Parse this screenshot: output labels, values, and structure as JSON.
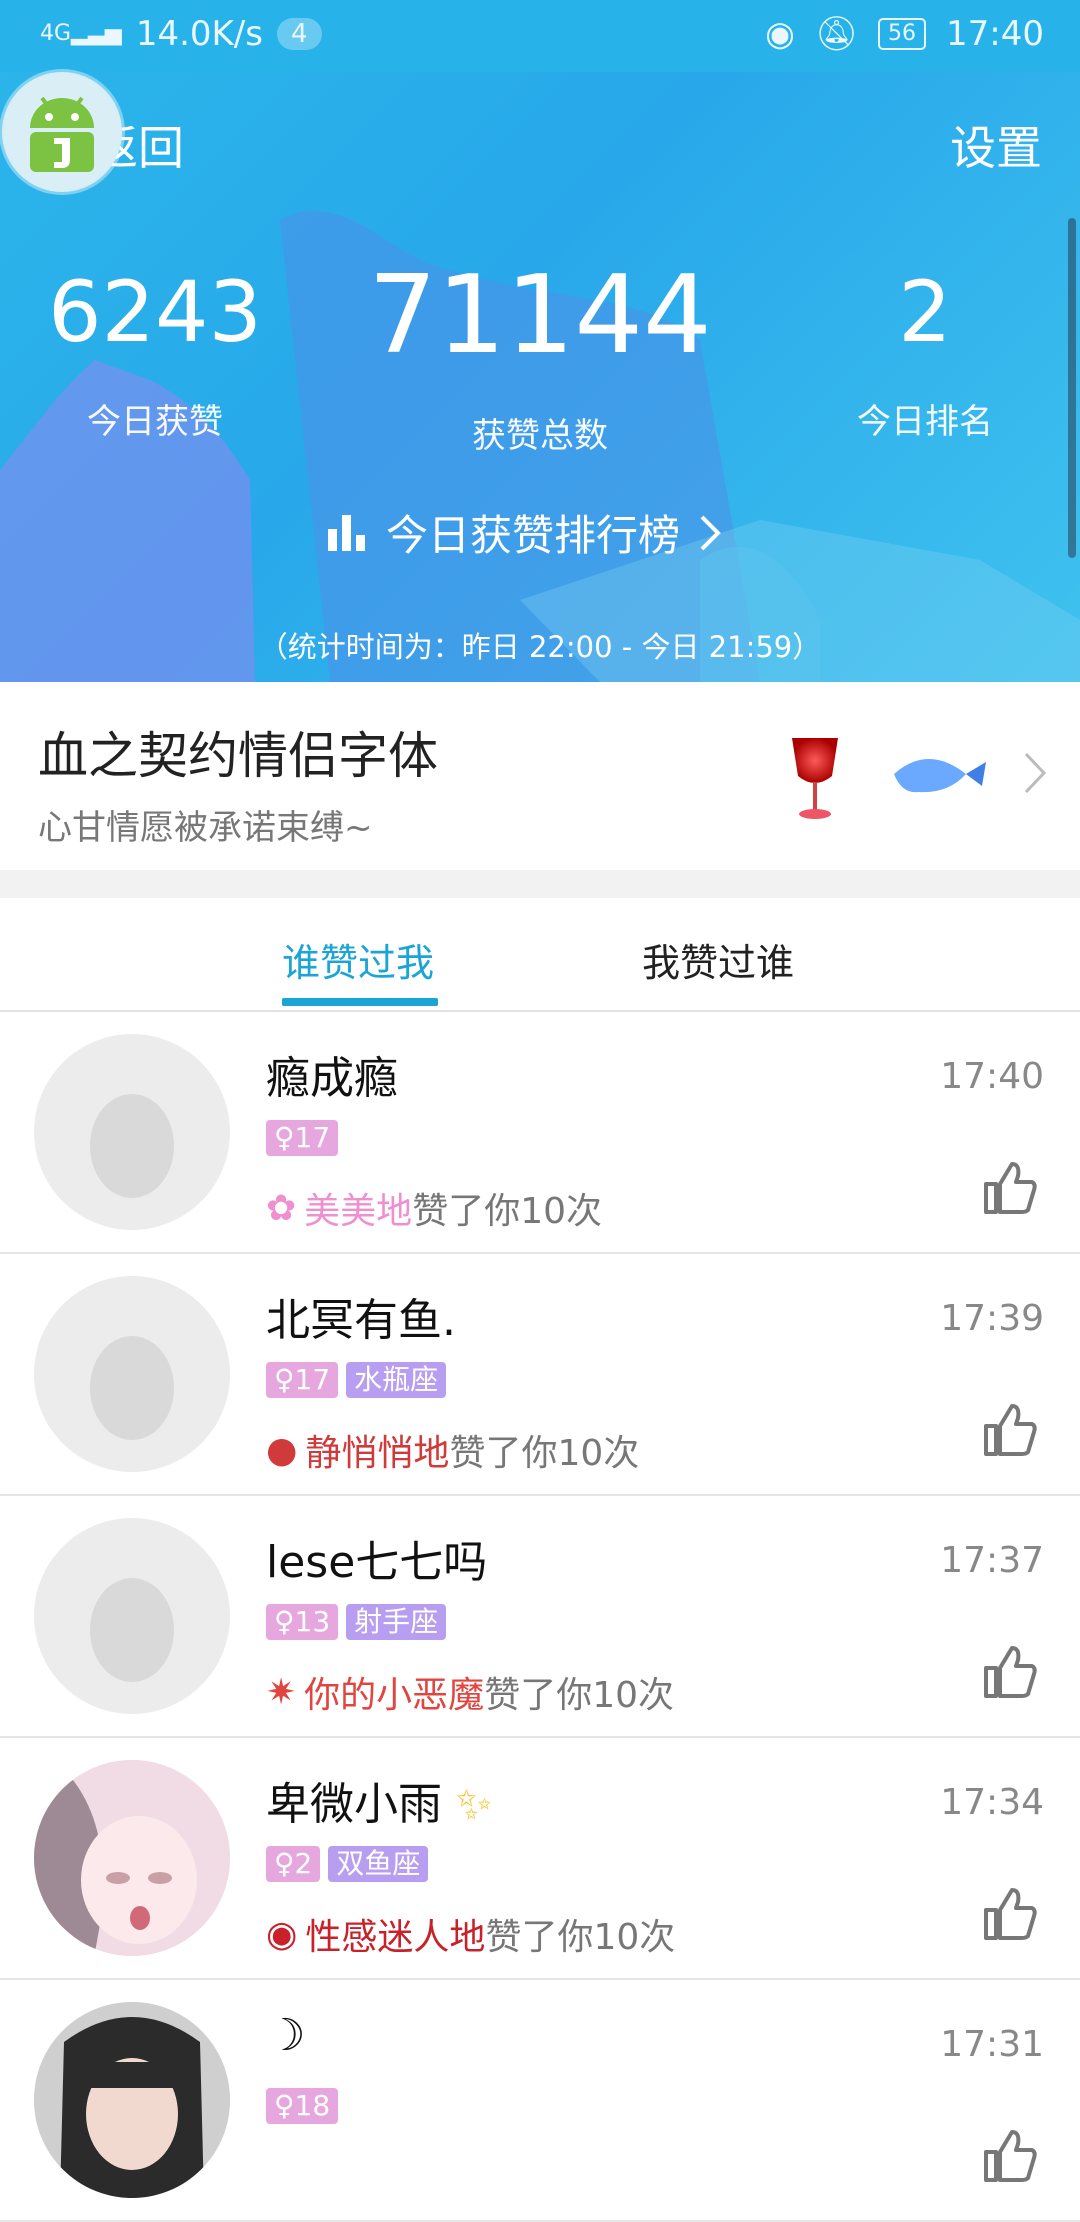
{
  "status_bar": {
    "network": "4G",
    "speed": "14.0K/s",
    "notif_count": "4",
    "battery": "56",
    "time": "17:40"
  },
  "header": {
    "back_label": "返回",
    "settings_label": "设置",
    "stats": [
      {
        "value": "6243",
        "label": "今日获赞"
      },
      {
        "value": "71144",
        "label": "获赞总数"
      },
      {
        "value": "2",
        "label": "今日排名"
      }
    ],
    "rank_link": "今日获赞排行榜",
    "stat_time": "（统计时间为：昨日 22:00 - 今日 21:59）"
  },
  "promo": {
    "title": "血之契约情侣字体",
    "subtitle": "心甘情愿被承诺束缚~"
  },
  "tabs": [
    {
      "label": "谁赞过我",
      "active": true
    },
    {
      "label": "我赞过谁",
      "active": false
    }
  ],
  "list": [
    {
      "name": "瘾成瘾",
      "time": "17:40",
      "age": "17",
      "star": "",
      "adverb": "美美地",
      "adverb_color": "#f08fd0",
      "icon": "flower-icon",
      "action": "赞了你10次"
    },
    {
      "name": "北冥有鱼.",
      "time": "17:39",
      "age": "17",
      "star": "水瓶座",
      "adverb": "静悄悄地",
      "adverb_color": "#d03a3a",
      "icon": "ghost-icon",
      "action": "赞了你10次"
    },
    {
      "name": "lese七七吗",
      "time": "17:37",
      "age": "13",
      "star": "射手座",
      "adverb": "你的小恶魔",
      "adverb_color": "#e0453f",
      "icon": "devil-icon",
      "action": "赞了你10次"
    },
    {
      "name": "卑微小雨",
      "time": "17:34",
      "age": "2",
      "star": "双鱼座",
      "adverb": "性感迷人地",
      "adverb_color": "#c8212a",
      "icon": "lips-icon",
      "action": "赞了你10次"
    },
    {
      "name": "☽",
      "time": "17:31",
      "age": "18",
      "star": "",
      "adverb": "",
      "adverb_color": "#aaaaaa",
      "icon": "",
      "action": ""
    }
  ]
}
